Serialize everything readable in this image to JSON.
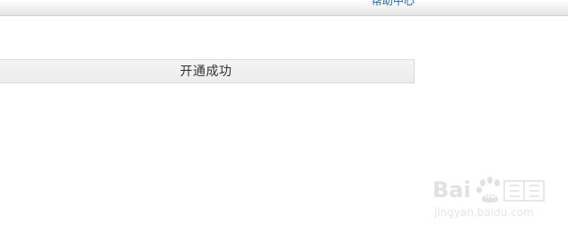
{
  "header": {
    "help_link_label": "帮助中心"
  },
  "main": {
    "status_message": "开通成功"
  },
  "watermark": {
    "logo_text": "Bai du 经验",
    "site": "jingyan.baidu.com"
  },
  "colors": {
    "link": "#1a6aa8",
    "status_bg": "#ececec",
    "status_text": "#333333"
  }
}
